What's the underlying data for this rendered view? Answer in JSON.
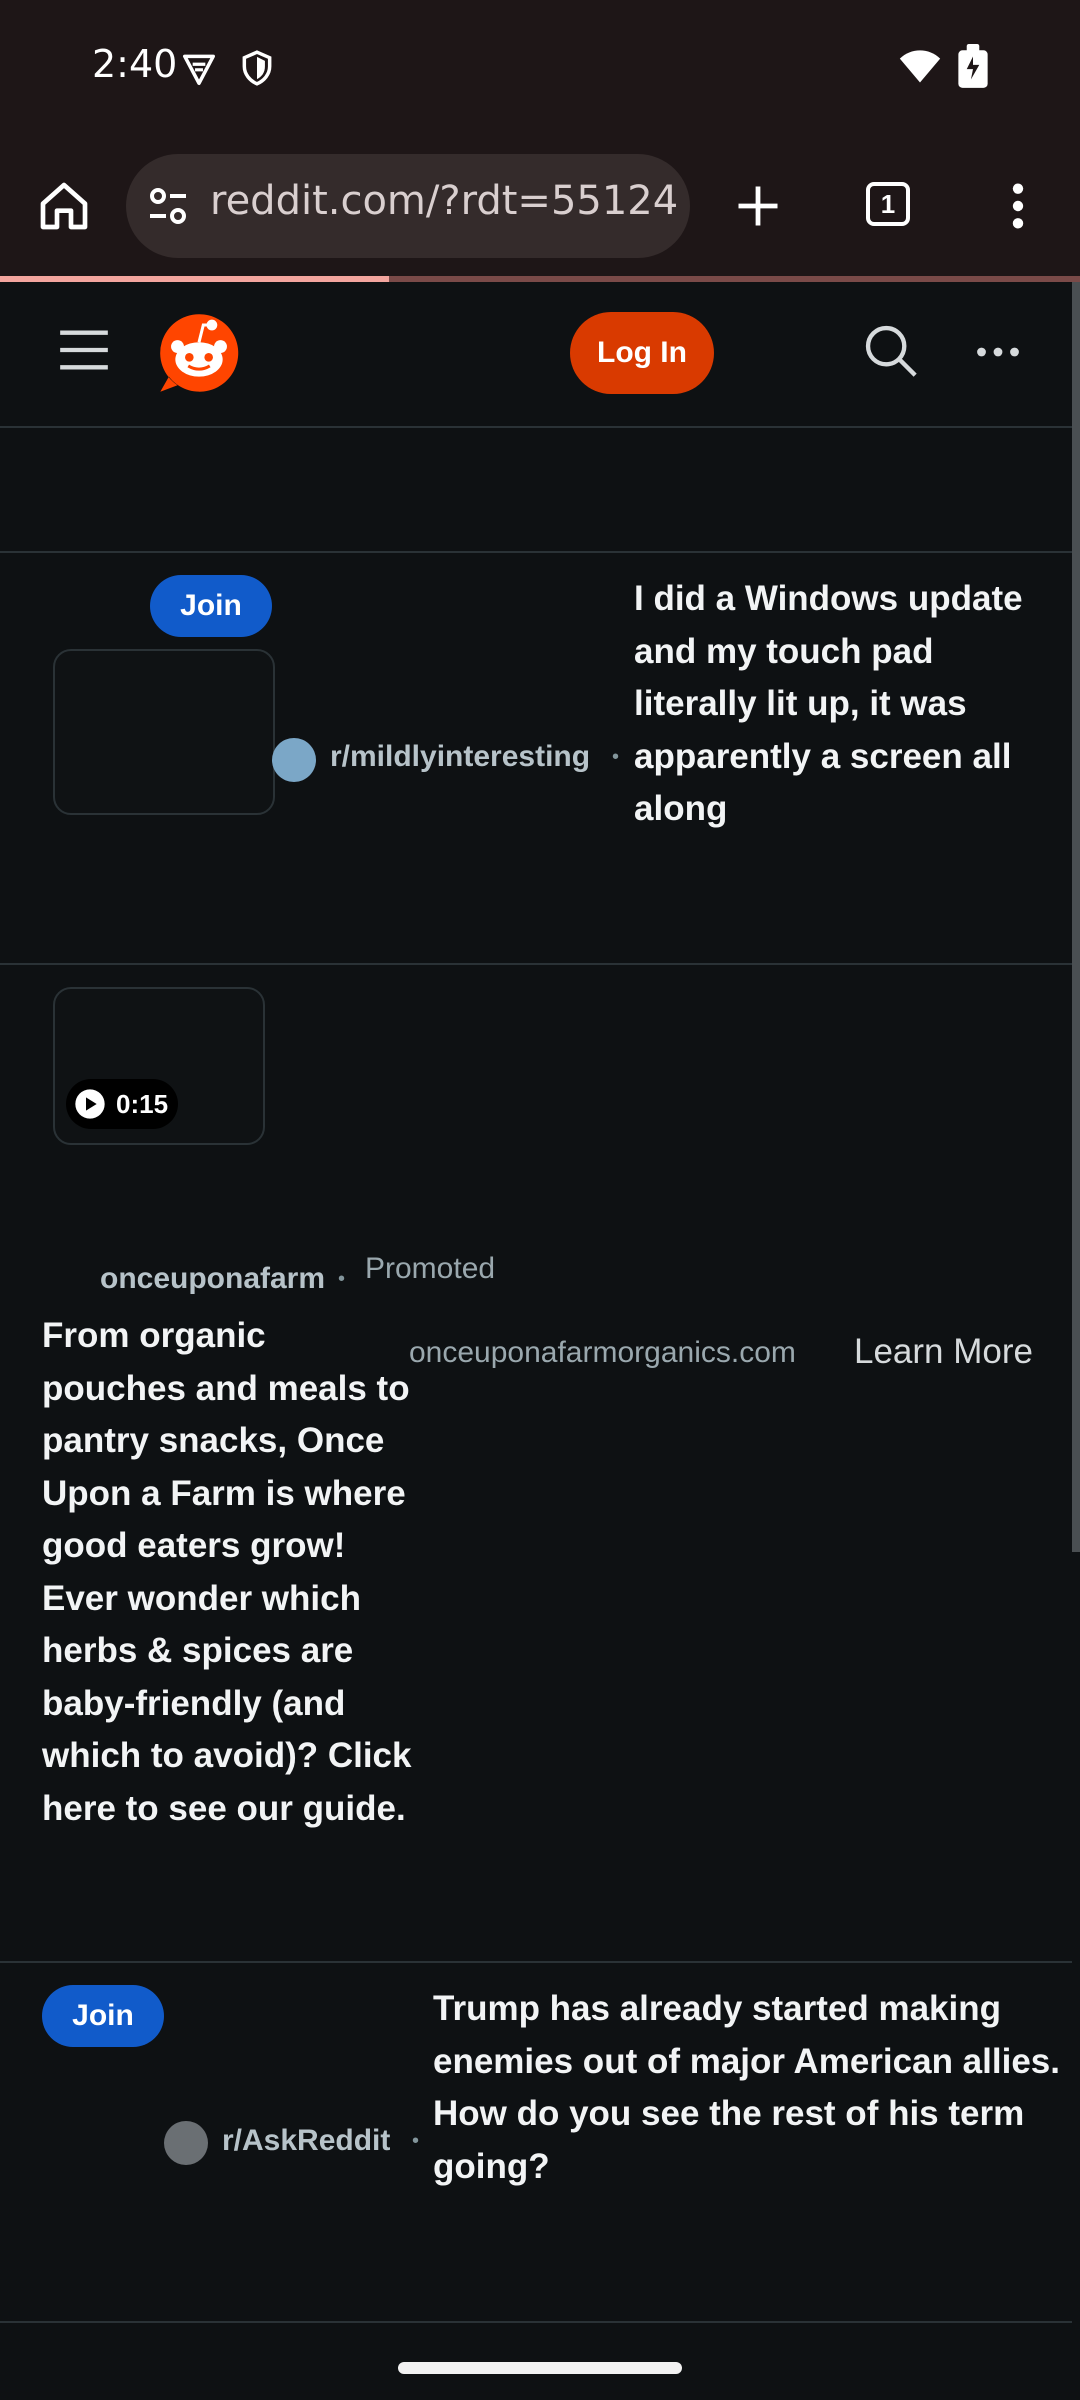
{
  "status_bar": {
    "time": "2:40",
    "left_icons": [
      "vpn-key-icon",
      "shield-icon"
    ],
    "right_icons": [
      "wifi-icon",
      "battery-icon"
    ]
  },
  "browser": {
    "url": "reddit.com/?rdt=55124",
    "tab_count": "1",
    "load_progress": 0.36
  },
  "reddit_header": {
    "login_label": "Log In"
  },
  "feed": {
    "post1": {
      "join_label": "Join",
      "subreddit": "r/mildlyinteresting",
      "title": "I did a Windows update and my touch pad literally lit up, it was apparently a screen all along"
    },
    "ad": {
      "video_duration": "0:15",
      "advertiser": "onceuponafarm",
      "promoted_label": "Promoted",
      "domain": "onceuponafarmorganics.com",
      "cta_label": "Learn More",
      "text": "From organic pouches and meals to pantry snacks, Once Upon a Farm is where good eaters grow! Ever wonder which herbs & spices are baby-friendly (and which to avoid)? Click here to see our guide."
    },
    "post2": {
      "join_label": "Join",
      "subreddit": "r/AskReddit",
      "title": "Trump has already started making enemies out of major American allies. How do you see the rest of his term going?"
    }
  },
  "colors": {
    "chrome_bg": "#1e1617",
    "page_bg": "#0e1113",
    "login_orange": "#d93a00",
    "join_blue": "#115bca",
    "reddit_orange": "#ff4500"
  }
}
